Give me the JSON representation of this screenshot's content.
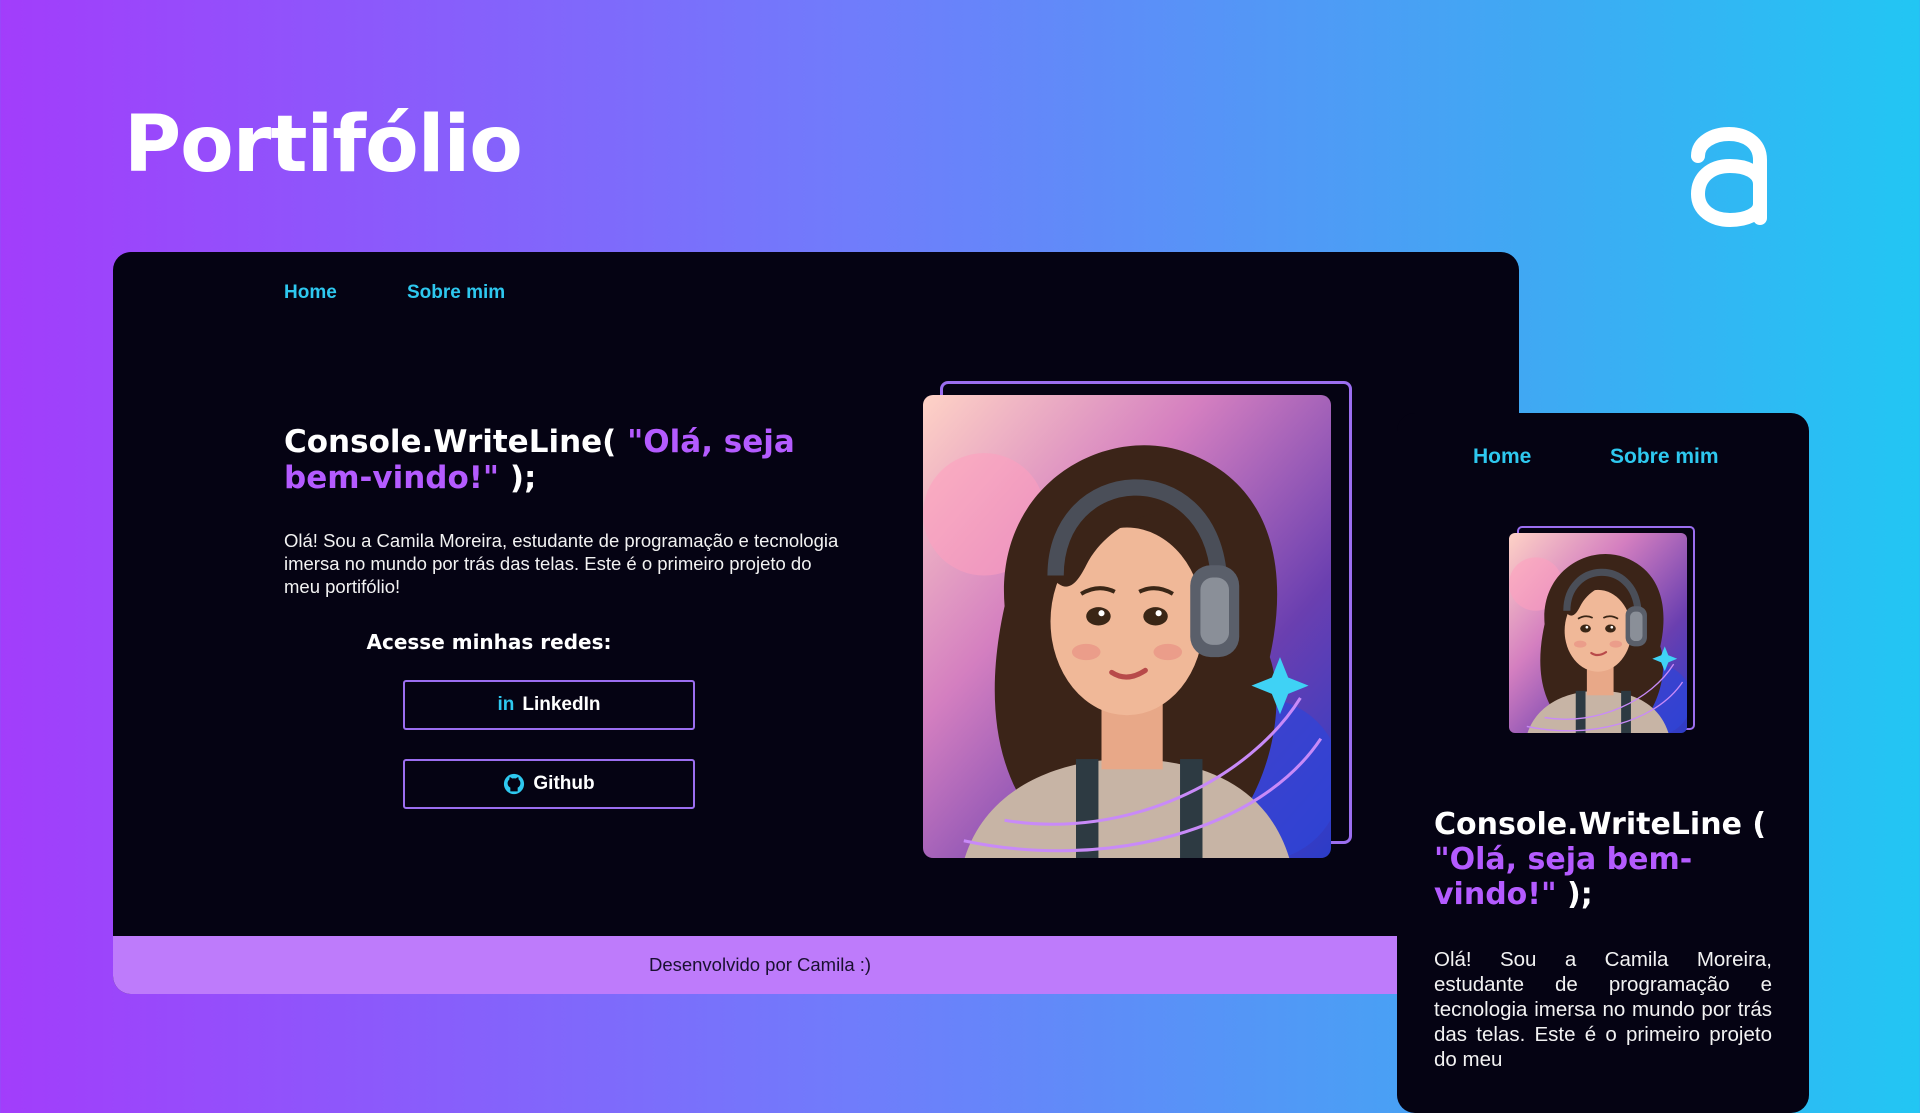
{
  "page": {
    "title": "Portifólio",
    "logo_icon": "alura-a-logo-icon"
  },
  "desktop": {
    "nav": {
      "home": "Home",
      "about": "Sobre mim"
    },
    "headline_prefix": "Console.WriteLine( ",
    "headline_string": "\"Olá, seja bem-vindo!\"",
    "headline_suffix": " );",
    "intro": "Olá! Sou a Camila Moreira, estudante de programação e tecnologia imersa no mundo por trás das telas. Este é o primeiro projeto do meu portifólio!",
    "social_heading": "Acesse minhas redes:",
    "linkedin_label": "LinkedIn",
    "github_label": "Github",
    "footer": "Desenvolvido por Camila :)"
  },
  "mobile": {
    "nav": {
      "home": "Home",
      "about": "Sobre mim"
    },
    "headline_prefix": "Console.WriteLine ( ",
    "headline_string": "\"Olá, seja bem-vindo!\"",
    "headline_suffix": " );",
    "intro": "Olá! Sou a Camila Moreira, estudante de programação e tecnologia imersa no mundo por trás das telas. Este é o primeiro projeto do meu"
  },
  "colors": {
    "nav_link": "#2ec8ef",
    "accent_purple": "#b45bff",
    "footer_bg": "#be7bfb",
    "card_bg": "#050313"
  }
}
